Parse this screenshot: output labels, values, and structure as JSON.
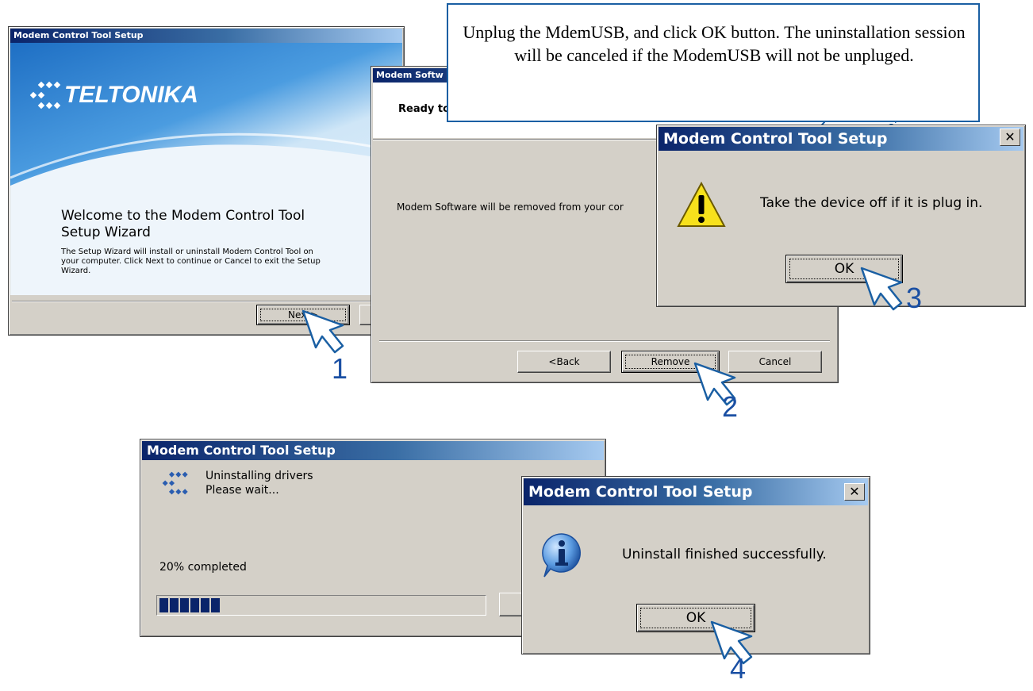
{
  "callout": {
    "text": "Unplug the MdemUSB, and click OK button. The uninstallation session will be canceled if the ModemUSB will not be unpluged."
  },
  "step1": {
    "title": "Modem Control Tool Setup",
    "logo_text": "TELTONIKA",
    "heading": "Welcome to the Modem Control Tool Setup Wizard",
    "body": "The Setup Wizard will install or uninstall Modem Control Tool on your computer. Click Next to continue or Cancel to exit the Setup Wizard.",
    "next_label": "Next>",
    "step_number": "1"
  },
  "step2": {
    "title": "Modem Softw",
    "header": "Ready to uninstall",
    "body": "Modem Software will be removed from your cor",
    "back_label": "<Back",
    "remove_label": "Remove",
    "cancel_label": "Cancel",
    "step_number": "2"
  },
  "step3": {
    "title": "Modem Control Tool Setup",
    "message": "Take the device off if it is plug in.",
    "ok_label": "OK",
    "step_number": "3"
  },
  "progress": {
    "title": "Modem Control Tool Setup",
    "line1": "Uninstalling drivers",
    "line2": "Please wait...",
    "status": "20% completed",
    "progress_value": 0.2
  },
  "step4": {
    "title": "Modem Control Tool Setup",
    "message": "Uninstall finished successfully.",
    "ok_label": "OK",
    "step_number": "4"
  },
  "colors": {
    "title_start": "#0a246a",
    "title_end": "#a6caf0",
    "step_number": "#1a4fa3",
    "progress_block": "#0a246a"
  }
}
